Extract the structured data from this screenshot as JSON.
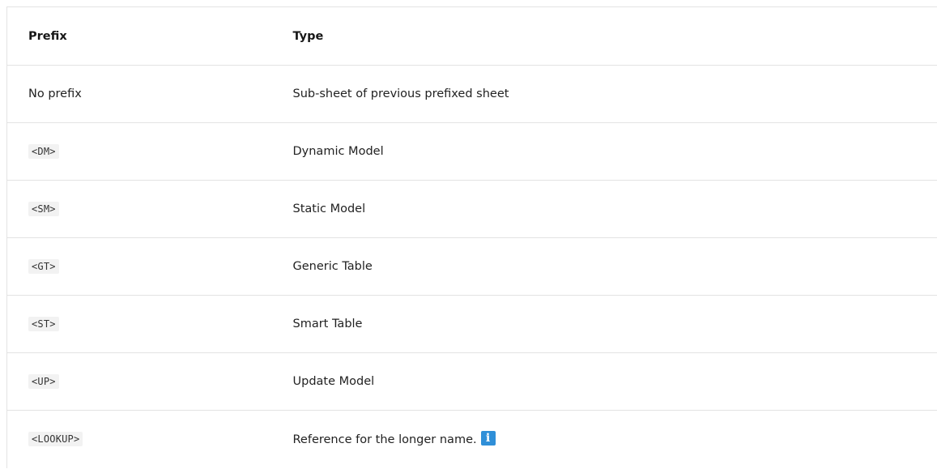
{
  "table": {
    "headers": {
      "prefix": "Prefix",
      "type": "Type"
    },
    "rows": [
      {
        "prefix": "No prefix",
        "prefix_is_code": false,
        "type": "Sub-sheet of previous prefixed sheet"
      },
      {
        "prefix": "<DM>",
        "prefix_is_code": true,
        "type": "Dynamic Model"
      },
      {
        "prefix": "<SM>",
        "prefix_is_code": true,
        "type": "Static Model"
      },
      {
        "prefix": "<GT>",
        "prefix_is_code": true,
        "type": "Generic Table"
      },
      {
        "prefix": "<ST>",
        "prefix_is_code": true,
        "type": "Smart Table"
      },
      {
        "prefix": "<UP>",
        "prefix_is_code": true,
        "type": "Update Model"
      },
      {
        "prefix": "<LOOKUP>",
        "prefix_is_code": true,
        "type": "Reference for the longer name."
      }
    ],
    "info_icon": {
      "icon": "info-icon",
      "glyph": "i",
      "color": "#2f8fd8"
    }
  }
}
